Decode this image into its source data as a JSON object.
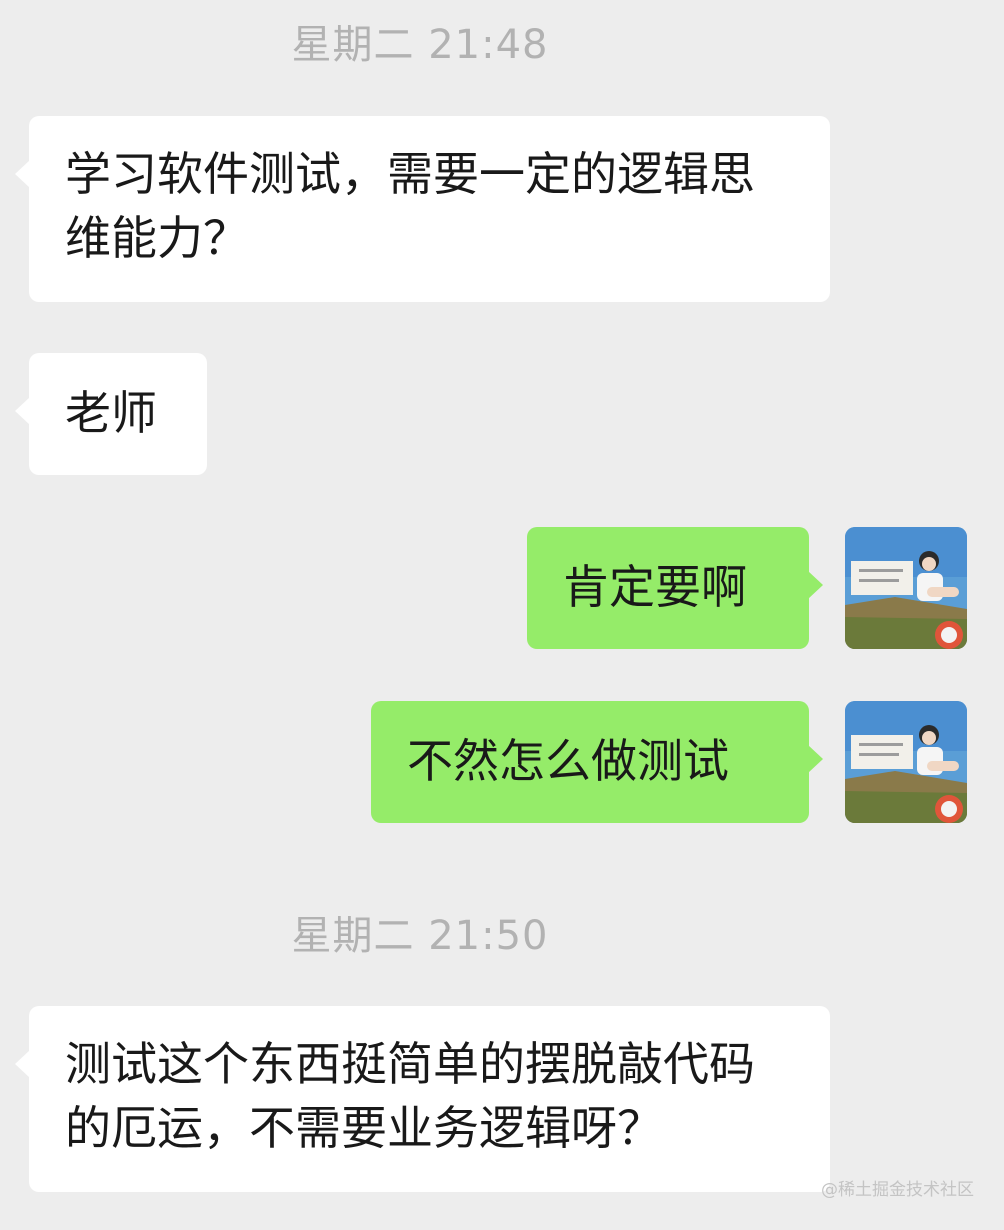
{
  "timestamps": [
    "星期二 21:48",
    "星期二 21:50"
  ],
  "messages": [
    {
      "from": "other",
      "text": "学习软件测试，需要一定的逻辑思维能力？"
    },
    {
      "from": "other",
      "text": "老师"
    },
    {
      "from": "me",
      "text": "肯定要啊"
    },
    {
      "from": "me",
      "text": "不然怎么做测试"
    },
    {
      "from": "other",
      "text": "测试这个东西挺简单的摆脱敲代码的厄运，不需要业务逻辑呀？"
    }
  ],
  "watermark": "@稀土掘金技术社区",
  "colors": {
    "background": "#ededed",
    "incoming_bubble": "#ffffff",
    "outgoing_bubble": "#95ec69",
    "timestamp_text": "#b2b2b2"
  },
  "avatar": {
    "icon": "user-photo-avatar"
  }
}
